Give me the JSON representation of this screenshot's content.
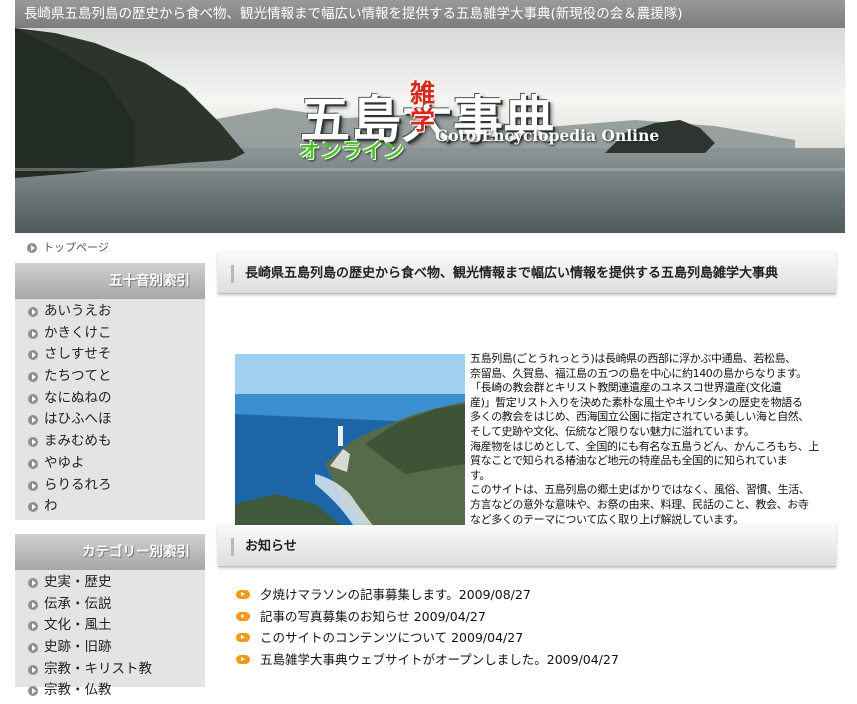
{
  "header": {
    "tagline": "長崎県五島列島の歴史から食べ物、観光情報まで幅広い情報を提供する五島雑学大事典(新現役の会＆農援隊)"
  },
  "logo": {
    "main": "五島大事典",
    "vertical": "雑学",
    "english": "Goto Encyclopedia Online",
    "online": "オンライン"
  },
  "breadcrumb": {
    "home": "トップページ"
  },
  "sidebar": {
    "index_title": "五十音別索引",
    "index_items": [
      "あいうえお",
      "かきくけこ",
      "さしすせそ",
      "たちつてと",
      "なにぬねの",
      "はひふへほ",
      "まみむめも",
      "やゆよ",
      "らりるれろ",
      "わ"
    ],
    "category_title": "カテゴリー別索引",
    "category_items": [
      "史実・歴史",
      "伝承・伝説",
      "文化・風土",
      "史跡・旧跡",
      "宗教・キリスト教",
      "宗教・仏教"
    ]
  },
  "main": {
    "heading": "長崎県五島列島の歴史から食べ物、観光情報まで幅広い情報を提供する五島列島雑学大事典",
    "intro_lines": [
      "五島列島(ごとうれっとう)は長崎県の西部に浮かぶ中通島、若松島、",
      "奈留島、久賀島、福江島の五つの島を中心に約140の島からなります。",
      "「長崎の教会群とキリスト教関連遺産のユネスコ世界遺産(文化遺",
      "産)」暫定リスト入りを決めた素朴な風土やキリシタンの歴史を物語る",
      "多くの教会をはじめ、西海国立公園に指定されている美しい海と自然、",
      "そして史跡や文化、伝統など限りない魅力に溢れています。",
      "海産物をはじめとして、全国的にも有名な五島うどん、かんころもち、上",
      "質なことで知られる椿油など地元の特産品も全国的に知られていま",
      "す。",
      "このサイトは、五島列島の郷土史ばかりではなく、風俗、習慣、生活、",
      "方言などの意外な意味や、お祭の由来、料理、民話のこと、教会、お寺",
      "など多くのテーマについて広く取り上げ解説しています。"
    ],
    "notice_heading": "お知らせ",
    "news": [
      "夕焼けマラソンの記事募集します。2009/08/27",
      "記事の写真募集のお知らせ 2009/04/27",
      "このサイトのコンテンツについて 2009/04/27",
      "五島雑学大事典ウェブサイトがオープンしました。2009/04/27"
    ]
  },
  "colors": {
    "topbar": "#8a8a8a",
    "sidebar_bg": "#e4e4e4",
    "news_bullet": "#f39a1c",
    "logo_red": "#d42a1e",
    "logo_green": "#48c81e"
  }
}
